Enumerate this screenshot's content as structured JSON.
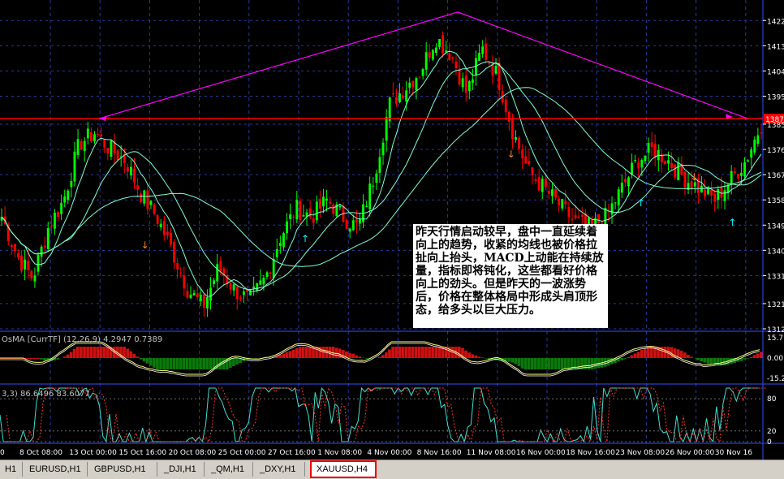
{
  "colors": {
    "background": "#000000",
    "candle_up": "#00ff00",
    "candle_down": "#ff0000",
    "ma_line": "#7fffd4",
    "neckline": "#ff0000",
    "shoulder_line": "#ff00ff",
    "grid": "#2a3aa0",
    "axis_text": "#ffffff",
    "signal_up_arrow": "#00ffff",
    "signal_down_arrow": "#ff7f27"
  },
  "price_axis": {
    "ticks": [
      "1422",
      "1413",
      "1404",
      "1395",
      "1385",
      "1376",
      "1367",
      "1358",
      "1349",
      "1340",
      "1331",
      "1321",
      "1312"
    ],
    "current_price": "1387"
  },
  "osma_panel": {
    "label": "OsMA [CurrTF] (12,26,9) 4.2947 0.7389",
    "ticks": [
      "15.71",
      "0.00",
      "-15.24"
    ]
  },
  "stoch_panel": {
    "label": "3,3) 86.6496 83.6077",
    "ticks": [
      "80",
      "20",
      "0"
    ]
  },
  "time_axis": {
    "labels": [
      "0",
      "8 Oct 08:00",
      "13 Oct 00:00",
      "15 Oct 16:00",
      "20 Oct 08:00",
      "25 Oct 00:00",
      "27 Oct 16:00",
      "1 Nov 08:00",
      "4 Nov 00:00",
      "8 Nov 16:00",
      "11 Nov 08:00",
      "16 Nov 00:00",
      "18 Nov 16:00",
      "23 Nov 08:00",
      "26 Nov 00:00",
      "30 Nov 16"
    ]
  },
  "annotation": {
    "text": "昨天行情启动较早，盘中一直延续着向上的趋势，收紧的均线也被价格拉扯向上抬头，MACD上动能在持续放量，指标即将钝化，这些都看好价格向上的劲头。但是昨天的一波涨势后，价格在整体格局中形成头肩顶形态，给多头以巨大压力。"
  },
  "symbol_tabs": [
    {
      "label": "H1"
    },
    {
      "label": "EURUSD,H1"
    },
    {
      "label": "GBPUSD,H1"
    },
    {
      "label": "_DJI,H1"
    },
    {
      "label": "_QM,H1"
    },
    {
      "label": "_DXY,H1"
    },
    {
      "label": "XAUUSD,H4",
      "active": true
    }
  ],
  "chart_data": {
    "type": "candlestick",
    "symbol": "XAUUSD",
    "timeframe": "H4",
    "ylim": [
      1312,
      1427
    ],
    "x_labels": [
      "0",
      "8 Oct 08:00",
      "13 Oct 00:00",
      "15 Oct 16:00",
      "20 Oct 08:00",
      "25 Oct 00:00",
      "27 Oct 16:00",
      "1 Nov 08:00",
      "4 Nov 00:00",
      "8 Nov 16:00",
      "11 Nov 08:00",
      "16 Nov 00:00",
      "18 Nov 16:00",
      "23 Nov 08:00",
      "26 Nov 00:00",
      "30 Nov 16"
    ],
    "price_path_keypoints": [
      1352,
      1338,
      1330,
      1348,
      1358,
      1378,
      1382,
      1376,
      1372,
      1360,
      1352,
      1340,
      1326,
      1320,
      1334,
      1326,
      1322,
      1330,
      1345,
      1355,
      1352,
      1358,
      1352,
      1348,
      1366,
      1392,
      1398,
      1404,
      1416,
      1410,
      1396,
      1412,
      1402,
      1382,
      1368,
      1362,
      1356,
      1350,
      1348,
      1352,
      1362,
      1372,
      1376,
      1372,
      1366,
      1362,
      1358,
      1365,
      1372,
      1385
    ],
    "neckline": 1387
  }
}
